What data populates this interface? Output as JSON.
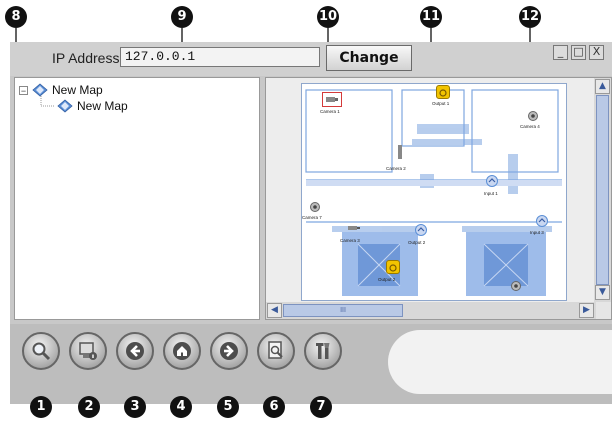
{
  "callouts": {
    "tree_panel": "8",
    "ip_field": "9",
    "camera_icon": "10",
    "output_icon": "11",
    "window_buttons": "12",
    "btn1": "1",
    "btn2": "2",
    "btn3": "3",
    "btn4": "4",
    "btn5": "5",
    "btn6": "6",
    "btn7": "7"
  },
  "toolbar": {
    "ip_label": "IP Address",
    "ip_value": "127.0.0.1",
    "change_label": "Change"
  },
  "window": {
    "minimize": "_",
    "maximize": "□",
    "close": "X"
  },
  "tree": {
    "root_label": "New Map",
    "child_label": "New Map",
    "expander": "−"
  },
  "map": {
    "labels": {
      "camera1": "Camera 1",
      "output1": "Output 1",
      "camera4": "Camera 4",
      "camera2": "Camera 2",
      "input1": "Input 1",
      "camera7": "Camera 7",
      "camera3": "Camera 3",
      "output2_mid": "Output 2",
      "input3": "Input 3",
      "output2": "Output 2"
    },
    "scroll_thumb_grip": "III"
  },
  "nav_buttons": [
    {
      "icon": "magnifier-icon"
    },
    {
      "icon": "device-info-icon"
    },
    {
      "icon": "arrow-left-icon"
    },
    {
      "icon": "home-icon"
    },
    {
      "icon": "arrow-right-icon"
    },
    {
      "icon": "page-search-icon"
    },
    {
      "icon": "tools-icon"
    }
  ],
  "colors": {
    "accent_blue": "#5b8fd6",
    "floor_blue": "#7ea6e0",
    "callout": "#111111",
    "highlight_red": "#d43a3a",
    "output_yellow": "#f2c400"
  }
}
